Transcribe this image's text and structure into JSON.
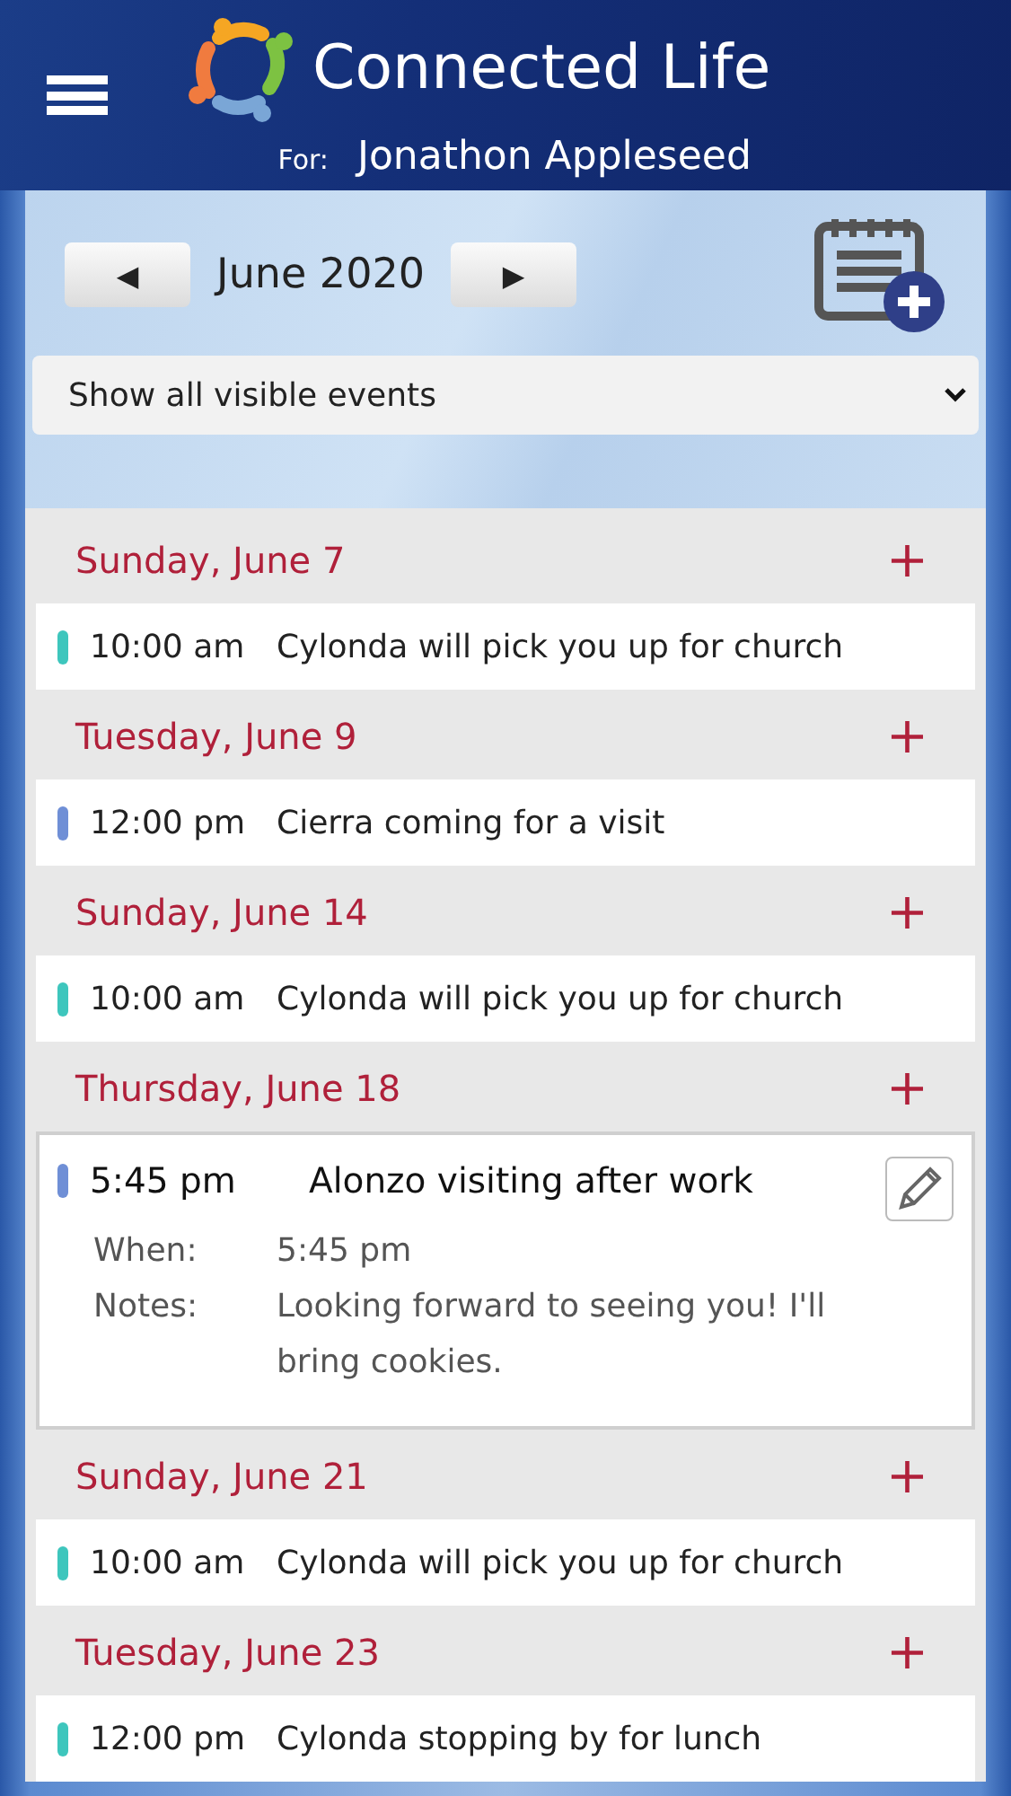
{
  "header": {
    "title": "Connected Life",
    "for_label": "For:",
    "person": "Jonathon Appleseed"
  },
  "month": {
    "label": "June 2020",
    "prev": "◀",
    "next": "▶"
  },
  "filter": {
    "value": "Show all visible events"
  },
  "days": [
    {
      "date": "Sunday, June 7",
      "add": "+",
      "events": [
        {
          "time": "10:00 am",
          "title": "Cylonda will pick you up for church",
          "color": "#3ec6bd",
          "expanded": false
        }
      ]
    },
    {
      "date": "Tuesday, June 9",
      "add": "+",
      "events": [
        {
          "time": "12:00 pm",
          "title": "Cierra coming for a visit",
          "color": "#6f8fd6",
          "expanded": false
        }
      ]
    },
    {
      "date": "Sunday, June 14",
      "add": "+",
      "events": [
        {
          "time": "10:00 am",
          "title": "Cylonda will pick you up for church",
          "color": "#3ec6bd",
          "expanded": false
        }
      ]
    },
    {
      "date": "Thursday, June 18",
      "add": "+",
      "events": [
        {
          "time": "5:45 pm",
          "title": "Alonzo visiting after work",
          "color": "#6f8fd6",
          "expanded": true,
          "details": [
            {
              "label": "When:",
              "value": "5:45 pm"
            },
            {
              "label": "Notes:",
              "value": "Looking forward to seeing you! I'll bring cookies."
            }
          ]
        }
      ]
    },
    {
      "date": "Sunday, June 21",
      "add": "+",
      "events": [
        {
          "time": "10:00 am",
          "title": "Cylonda will pick you up for church",
          "color": "#3ec6bd",
          "expanded": false
        }
      ]
    },
    {
      "date": "Tuesday, June 23",
      "add": "+",
      "events": [
        {
          "time": "12:00 pm",
          "title": "Cylonda stopping by for lunch",
          "color": "#3ec6bd",
          "expanded": false
        }
      ]
    }
  ]
}
